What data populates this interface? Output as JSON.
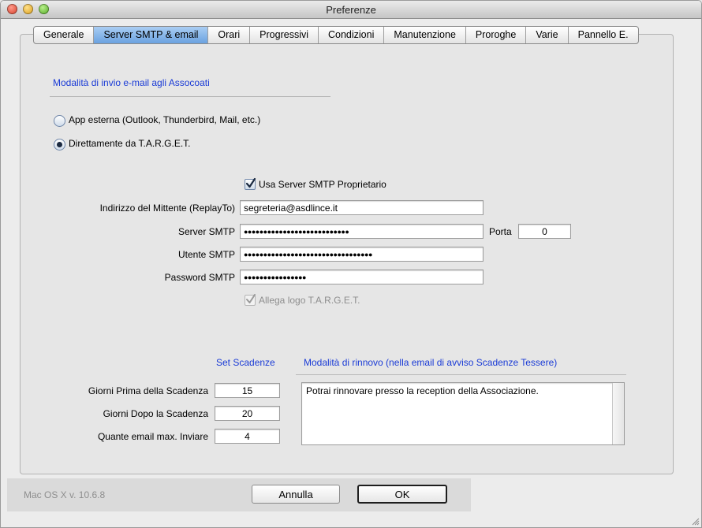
{
  "window": {
    "title": "Preferenze"
  },
  "tabs": [
    {
      "label": "Generale",
      "active": false
    },
    {
      "label": "Server SMTP & email",
      "active": true
    },
    {
      "label": "Orari",
      "active": false
    },
    {
      "label": "Progressivi",
      "active": false
    },
    {
      "label": "Condizioni",
      "active": false
    },
    {
      "label": "Manutenzione",
      "active": false
    },
    {
      "label": "Proroghe",
      "active": false
    },
    {
      "label": "Varie",
      "active": false
    },
    {
      "label": "Pannello E.",
      "active": false
    }
  ],
  "send_mode": {
    "heading": "Modalità di invio e-mail agli Assocoati",
    "option_external": "App esterna (Outlook, Thunderbird, Mail, etc.)",
    "option_direct": "Direttamente da T.A.R.G.E.T.",
    "selected": "direct"
  },
  "smtp": {
    "use_own_server_label": "Usa Server SMTP Proprietario",
    "use_own_server_checked": true,
    "sender_label": "Indirizzo del Mittente (ReplayTo)",
    "sender_value": "segreteria@asdlince.it",
    "server_label": "Server SMTP",
    "server_value": "●●●●●●●●●●●●●●●●●●●●●●●●●●●",
    "port_label": "Porta",
    "port_value": "0",
    "user_label": "Utente SMTP",
    "user_value": "●●●●●●●●●●●●●●●●●●●●●●●●●●●●●●●●●",
    "password_label": "Password SMTP",
    "password_value": "●●●●●●●●●●●●●●●●",
    "attach_logo_label": "Allega logo T.A.R.G.E.T.",
    "attach_logo_checked": true
  },
  "deadlines": {
    "heading": "Set Scadenze",
    "days_before_label": "Giorni Prima della Scadenza",
    "days_before_value": "15",
    "days_after_label": "Giorni Dopo la Scadenza",
    "days_after_value": "20",
    "max_emails_label": "Quante email max. Inviare",
    "max_emails_value": "4"
  },
  "renewal": {
    "heading": "Modalità di rinnovo (nella email di avviso Scadenze Tessere)",
    "text": "Potrai rinnovare presso la reception della Associazione."
  },
  "footer": {
    "os_label": "Mac OS X v. 10.6.8",
    "cancel_label": "Annulla",
    "ok_label": "OK"
  },
  "colors": {
    "accent_blue": "#1a3bd6",
    "tab_active": "#8fbbeb"
  }
}
